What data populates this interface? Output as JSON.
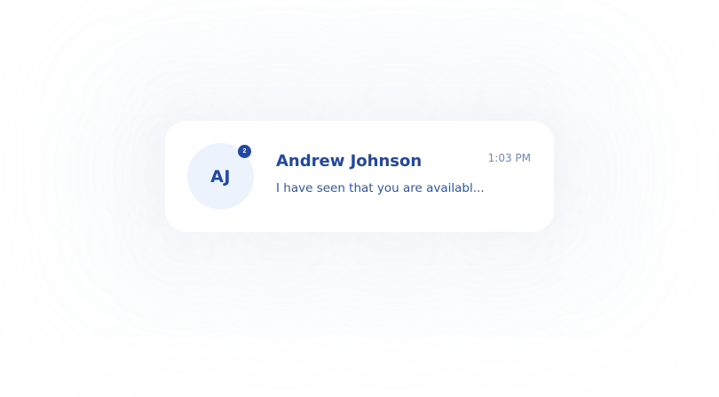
{
  "conversation": {
    "avatar_initials": "AJ",
    "unread_count": "2",
    "contact_name": "Andrew Johnson",
    "message_preview": "I have seen that you are availabl...",
    "timestamp": "1:03 PM"
  },
  "colors": {
    "accent": "#2448a2",
    "avatar_background": "#edf3fd",
    "timestamp": "#7088bf",
    "card_background": "#ffffff"
  }
}
